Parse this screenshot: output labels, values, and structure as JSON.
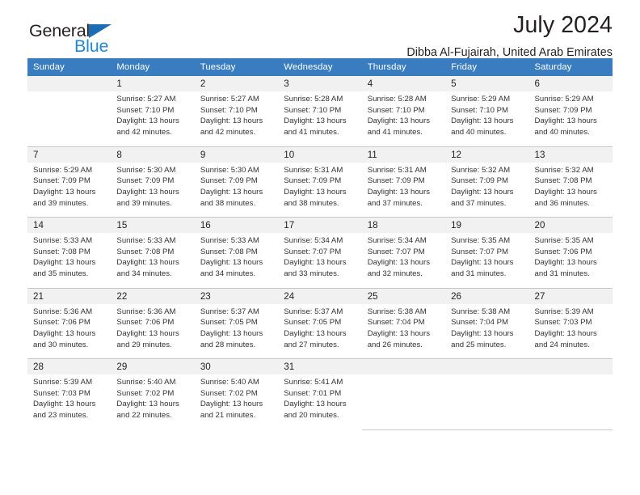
{
  "brand": {
    "name_part1": "General",
    "name_part2": "Blue",
    "triangle_color": "#1a6db5",
    "blue_color": "#2288d6"
  },
  "header": {
    "title": "July 2024",
    "subtitle": "Dibba Al-Fujairah, United Arab Emirates",
    "header_bg": "#3a7cc0",
    "number_band_bg": "#f1f1f1"
  },
  "weekdays": [
    "Sunday",
    "Monday",
    "Tuesday",
    "Wednesday",
    "Thursday",
    "Friday",
    "Saturday"
  ],
  "weeks": [
    [
      {
        "day": "",
        "sunrise": "",
        "sunset": "",
        "daylight1": "",
        "daylight2": ""
      },
      {
        "day": "1",
        "sunrise": "Sunrise: 5:27 AM",
        "sunset": "Sunset: 7:10 PM",
        "daylight1": "Daylight: 13 hours",
        "daylight2": "and 42 minutes."
      },
      {
        "day": "2",
        "sunrise": "Sunrise: 5:27 AM",
        "sunset": "Sunset: 7:10 PM",
        "daylight1": "Daylight: 13 hours",
        "daylight2": "and 42 minutes."
      },
      {
        "day": "3",
        "sunrise": "Sunrise: 5:28 AM",
        "sunset": "Sunset: 7:10 PM",
        "daylight1": "Daylight: 13 hours",
        "daylight2": "and 41 minutes."
      },
      {
        "day": "4",
        "sunrise": "Sunrise: 5:28 AM",
        "sunset": "Sunset: 7:10 PM",
        "daylight1": "Daylight: 13 hours",
        "daylight2": "and 41 minutes."
      },
      {
        "day": "5",
        "sunrise": "Sunrise: 5:29 AM",
        "sunset": "Sunset: 7:10 PM",
        "daylight1": "Daylight: 13 hours",
        "daylight2": "and 40 minutes."
      },
      {
        "day": "6",
        "sunrise": "Sunrise: 5:29 AM",
        "sunset": "Sunset: 7:09 PM",
        "daylight1": "Daylight: 13 hours",
        "daylight2": "and 40 minutes."
      }
    ],
    [
      {
        "day": "7",
        "sunrise": "Sunrise: 5:29 AM",
        "sunset": "Sunset: 7:09 PM",
        "daylight1": "Daylight: 13 hours",
        "daylight2": "and 39 minutes."
      },
      {
        "day": "8",
        "sunrise": "Sunrise: 5:30 AM",
        "sunset": "Sunset: 7:09 PM",
        "daylight1": "Daylight: 13 hours",
        "daylight2": "and 39 minutes."
      },
      {
        "day": "9",
        "sunrise": "Sunrise: 5:30 AM",
        "sunset": "Sunset: 7:09 PM",
        "daylight1": "Daylight: 13 hours",
        "daylight2": "and 38 minutes."
      },
      {
        "day": "10",
        "sunrise": "Sunrise: 5:31 AM",
        "sunset": "Sunset: 7:09 PM",
        "daylight1": "Daylight: 13 hours",
        "daylight2": "and 38 minutes."
      },
      {
        "day": "11",
        "sunrise": "Sunrise: 5:31 AM",
        "sunset": "Sunset: 7:09 PM",
        "daylight1": "Daylight: 13 hours",
        "daylight2": "and 37 minutes."
      },
      {
        "day": "12",
        "sunrise": "Sunrise: 5:32 AM",
        "sunset": "Sunset: 7:09 PM",
        "daylight1": "Daylight: 13 hours",
        "daylight2": "and 37 minutes."
      },
      {
        "day": "13",
        "sunrise": "Sunrise: 5:32 AM",
        "sunset": "Sunset: 7:08 PM",
        "daylight1": "Daylight: 13 hours",
        "daylight2": "and 36 minutes."
      }
    ],
    [
      {
        "day": "14",
        "sunrise": "Sunrise: 5:33 AM",
        "sunset": "Sunset: 7:08 PM",
        "daylight1": "Daylight: 13 hours",
        "daylight2": "and 35 minutes."
      },
      {
        "day": "15",
        "sunrise": "Sunrise: 5:33 AM",
        "sunset": "Sunset: 7:08 PM",
        "daylight1": "Daylight: 13 hours",
        "daylight2": "and 34 minutes."
      },
      {
        "day": "16",
        "sunrise": "Sunrise: 5:33 AM",
        "sunset": "Sunset: 7:08 PM",
        "daylight1": "Daylight: 13 hours",
        "daylight2": "and 34 minutes."
      },
      {
        "day": "17",
        "sunrise": "Sunrise: 5:34 AM",
        "sunset": "Sunset: 7:07 PM",
        "daylight1": "Daylight: 13 hours",
        "daylight2": "and 33 minutes."
      },
      {
        "day": "18",
        "sunrise": "Sunrise: 5:34 AM",
        "sunset": "Sunset: 7:07 PM",
        "daylight1": "Daylight: 13 hours",
        "daylight2": "and 32 minutes."
      },
      {
        "day": "19",
        "sunrise": "Sunrise: 5:35 AM",
        "sunset": "Sunset: 7:07 PM",
        "daylight1": "Daylight: 13 hours",
        "daylight2": "and 31 minutes."
      },
      {
        "day": "20",
        "sunrise": "Sunrise: 5:35 AM",
        "sunset": "Sunset: 7:06 PM",
        "daylight1": "Daylight: 13 hours",
        "daylight2": "and 31 minutes."
      }
    ],
    [
      {
        "day": "21",
        "sunrise": "Sunrise: 5:36 AM",
        "sunset": "Sunset: 7:06 PM",
        "daylight1": "Daylight: 13 hours",
        "daylight2": "and 30 minutes."
      },
      {
        "day": "22",
        "sunrise": "Sunrise: 5:36 AM",
        "sunset": "Sunset: 7:06 PM",
        "daylight1": "Daylight: 13 hours",
        "daylight2": "and 29 minutes."
      },
      {
        "day": "23",
        "sunrise": "Sunrise: 5:37 AM",
        "sunset": "Sunset: 7:05 PM",
        "daylight1": "Daylight: 13 hours",
        "daylight2": "and 28 minutes."
      },
      {
        "day": "24",
        "sunrise": "Sunrise: 5:37 AM",
        "sunset": "Sunset: 7:05 PM",
        "daylight1": "Daylight: 13 hours",
        "daylight2": "and 27 minutes."
      },
      {
        "day": "25",
        "sunrise": "Sunrise: 5:38 AM",
        "sunset": "Sunset: 7:04 PM",
        "daylight1": "Daylight: 13 hours",
        "daylight2": "and 26 minutes."
      },
      {
        "day": "26",
        "sunrise": "Sunrise: 5:38 AM",
        "sunset": "Sunset: 7:04 PM",
        "daylight1": "Daylight: 13 hours",
        "daylight2": "and 25 minutes."
      },
      {
        "day": "27",
        "sunrise": "Sunrise: 5:39 AM",
        "sunset": "Sunset: 7:03 PM",
        "daylight1": "Daylight: 13 hours",
        "daylight2": "and 24 minutes."
      }
    ],
    [
      {
        "day": "28",
        "sunrise": "Sunrise: 5:39 AM",
        "sunset": "Sunset: 7:03 PM",
        "daylight1": "Daylight: 13 hours",
        "daylight2": "and 23 minutes."
      },
      {
        "day": "29",
        "sunrise": "Sunrise: 5:40 AM",
        "sunset": "Sunset: 7:02 PM",
        "daylight1": "Daylight: 13 hours",
        "daylight2": "and 22 minutes."
      },
      {
        "day": "30",
        "sunrise": "Sunrise: 5:40 AM",
        "sunset": "Sunset: 7:02 PM",
        "daylight1": "Daylight: 13 hours",
        "daylight2": "and 21 minutes."
      },
      {
        "day": "31",
        "sunrise": "Sunrise: 5:41 AM",
        "sunset": "Sunset: 7:01 PM",
        "daylight1": "Daylight: 13 hours",
        "daylight2": "and 20 minutes."
      },
      {
        "day": "",
        "sunrise": "",
        "sunset": "",
        "daylight1": "",
        "daylight2": ""
      },
      {
        "day": "",
        "sunrise": "",
        "sunset": "",
        "daylight1": "",
        "daylight2": ""
      },
      {
        "day": "",
        "sunrise": "",
        "sunset": "",
        "daylight1": "",
        "daylight2": ""
      }
    ]
  ]
}
